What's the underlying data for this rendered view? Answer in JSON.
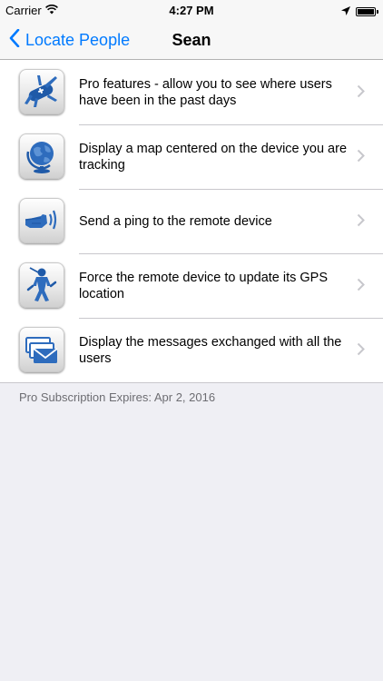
{
  "status_bar": {
    "carrier": "Carrier",
    "time": "4:27 PM"
  },
  "nav": {
    "back_label": "Locate People",
    "title": "Sean"
  },
  "rows": [
    {
      "text": "Pro features - allow you to see where users have been in the past days",
      "icon": "swiss-knife-icon"
    },
    {
      "text": "Display a map centered on the device you are tracking",
      "icon": "globe-icon"
    },
    {
      "text": "Send a ping to the remote device",
      "icon": "pointing-hand-icon"
    },
    {
      "text": "Force the remote device to update its GPS location",
      "icon": "ninja-icon"
    },
    {
      "text": "Display the messages exchanged with all the users",
      "icon": "envelopes-icon"
    }
  ],
  "footer": {
    "text": "Pro Subscription Expires: Apr 2, 2016"
  },
  "colors": {
    "accent": "#007aff",
    "icon_blue": "#1f5aa8"
  }
}
